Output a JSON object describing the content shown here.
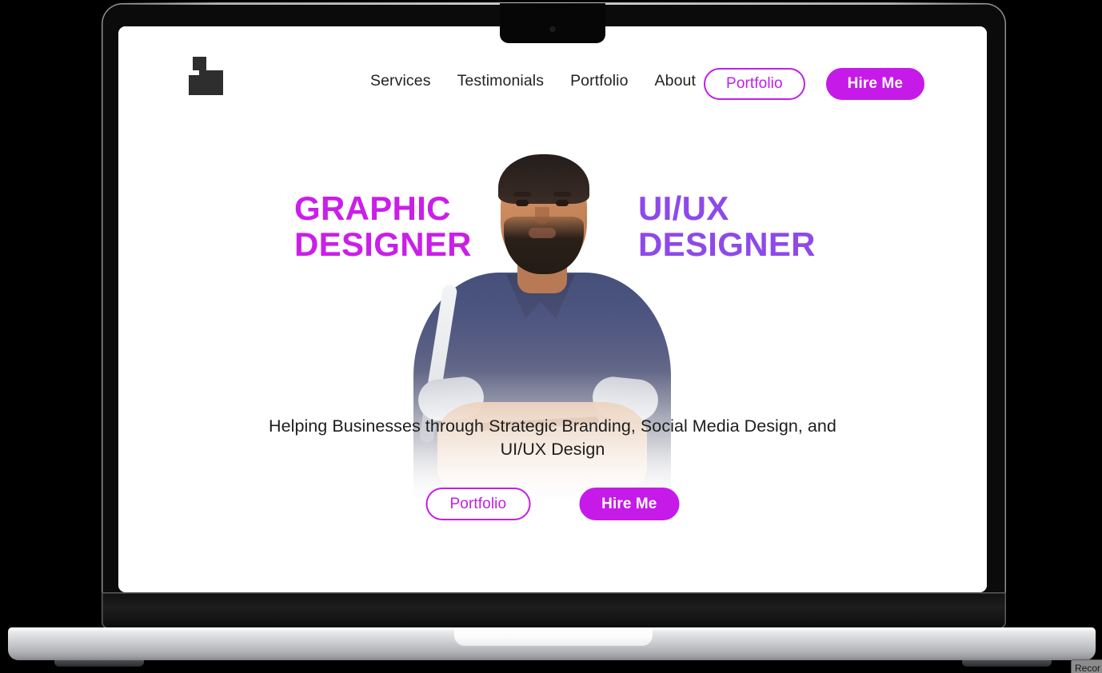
{
  "device": {
    "type": "laptop-mockup",
    "notch": "camera-notch"
  },
  "site": {
    "header": {
      "logo_name": "brand-logo",
      "nav": [
        {
          "label": "Services"
        },
        {
          "label": "Testimonials"
        },
        {
          "label": "Portfolio"
        },
        {
          "label": "About"
        }
      ],
      "actions": {
        "portfolio_label": "Portfolio",
        "hire_label": "Hire Me"
      }
    },
    "hero": {
      "title_left_line1": "GRAPHIC",
      "title_left_line2": "DESIGNER",
      "title_right_line1": "UI/UX",
      "title_right_line2": "DESIGNER",
      "tagline": "Helping Businesses through Strategic Branding, Social Media Design, and UI/UX Design",
      "portrait_alt": "portrait of designer with arms crossed",
      "actions": {
        "portfolio_label": "Portfolio",
        "hire_label": "Hire Me"
      }
    }
  },
  "overlay": {
    "recording_chip_label": "Recor"
  },
  "colors": {
    "accent_magenta": "#c51ae8",
    "accent_violet": "#8e4ae8",
    "page_background": "#ffffff",
    "text_dark": "#232323",
    "device_body": "#0b0b0b",
    "device_base": "#c9cbce"
  }
}
